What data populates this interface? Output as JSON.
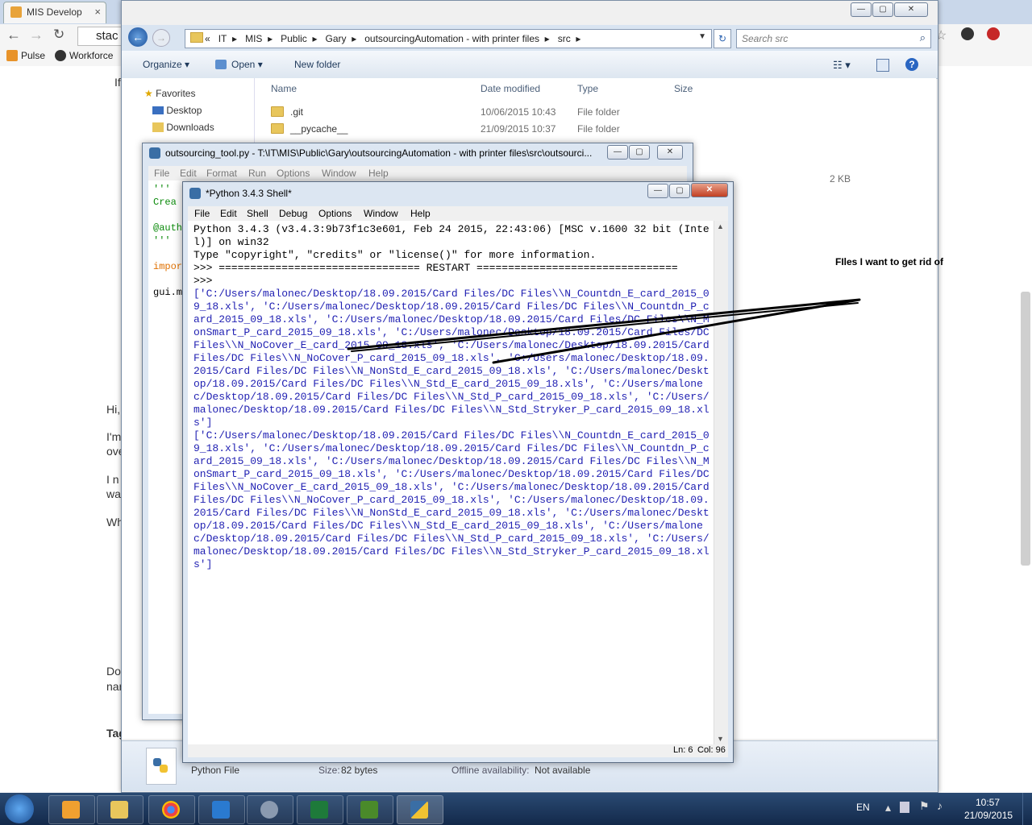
{
  "chrome": {
    "tab_title": "MIS Develop",
    "tab_close": "×",
    "address_partial": "stac",
    "bookmarks": [
      "Pulse",
      "Workforce"
    ],
    "page_fragments": [
      "If",
      "Hi,",
      "I'm",
      "ove",
      "I n",
      "wa",
      "Wh",
      "Do",
      "nar",
      "Tag"
    ]
  },
  "explorer": {
    "breadcrumb": [
      "«",
      "IT",
      "MIS",
      "Public",
      "Gary",
      "outsourcingAutomation - with printer files",
      "src"
    ],
    "search_placeholder": "Search src",
    "commands": {
      "organize": "Organize",
      "open": "Open",
      "new_folder": "New folder"
    },
    "nav": {
      "favorites": "Favorites",
      "desktop": "Desktop",
      "downloads": "Downloads"
    },
    "columns": {
      "name": "Name",
      "date": "Date modified",
      "type": "Type",
      "size": "Size"
    },
    "files": [
      {
        "name": ".git",
        "date": "10/06/2015 10:43",
        "type": "File folder"
      },
      {
        "name": "__pycache__",
        "date": "21/09/2015 10:37",
        "type": "File folder"
      }
    ],
    "partial_size": "2 KB",
    "details": {
      "type": "Python File",
      "size_label": "Size:",
      "size_value": "82 bytes",
      "offline_label": "Offline availability:",
      "offline_value": "Not available"
    }
  },
  "editor": {
    "title": "outsourcing_tool.py - T:\\IT\\MIS\\Public\\Gary\\outsourcingAutomation - with printer files\\src\\outsourci...",
    "menu": [
      "File",
      "Edit",
      "Format",
      "Run",
      "Options",
      "Window",
      "Help"
    ],
    "lines": [
      "'''",
      "Crea",
      "",
      "@auth",
      "'''",
      "",
      "impor",
      "",
      "gui.m"
    ]
  },
  "shell": {
    "title": "*Python 3.4.3 Shell*",
    "menu": [
      "File",
      "Edit",
      "Shell",
      "Debug",
      "Options",
      "Window",
      "Help"
    ],
    "header": "Python 3.4.3 (v3.4.3:9b73f1c3e601, Feb 24 2015, 22:43:06) [MSC v.1600 32 bit (Intel)] on win32\nType \"copyright\", \"credits\" or \"license()\" for more information.\n>>> ================================ RESTART ================================\n>>> ",
    "output1": "['C:/Users/malonec/Desktop/18.09.2015/Card Files/DC Files\\\\N_Countdn_E_card_2015_09_18.xls', 'C:/Users/malonec/Desktop/18.09.2015/Card Files/DC Files\\\\N_Countdn_P_card_2015_09_18.xls', 'C:/Users/malonec/Desktop/18.09.2015/Card Files/DC Files\\\\N_MonSmart_P_card_2015_09_18.xls', 'C:/Users/malonec/Desktop/18.09.2015/Card Files/DC Files\\\\N_NoCover_E_card_2015_09_18.xls', 'C:/Users/malonec/Desktop/18.09.2015/Card Files/DC Files\\\\N_NoCover_P_card_2015_09_18.xls', 'C:/Users/malonec/Desktop/18.09.2015/Card Files/DC Files\\\\N_NonStd_E_card_2015_09_18.xls', 'C:/Users/malonec/Desktop/18.09.2015/Card Files/DC Files\\\\N_Std_E_card_2015_09_18.xls', 'C:/Users/malonec/Desktop/18.09.2015/Card Files/DC Files\\\\N_Std_P_card_2015_09_18.xls', 'C:/Users/malonec/Desktop/18.09.2015/Card Files/DC Files\\\\N_Std_Stryker_P_card_2015_09_18.xls']",
    "output2": "['C:/Users/malonec/Desktop/18.09.2015/Card Files/DC Files\\\\N_Countdn_E_card_2015_09_18.xls', 'C:/Users/malonec/Desktop/18.09.2015/Card Files/DC Files\\\\N_Countdn_P_card_2015_09_18.xls', 'C:/Users/malonec/Desktop/18.09.2015/Card Files/DC Files\\\\N_MonSmart_P_card_2015_09_18.xls', 'C:/Users/malonec/Desktop/18.09.2015/Card Files/DC Files\\\\N_NoCover_E_card_2015_09_18.xls', 'C:/Users/malonec/Desktop/18.09.2015/Card Files/DC Files\\\\N_NoCover_P_card_2015_09_18.xls', 'C:/Users/malonec/Desktop/18.09.2015/Card Files/DC Files\\\\N_NonStd_E_card_2015_09_18.xls', 'C:/Users/malonec/Desktop/18.09.2015/Card Files/DC Files\\\\N_Std_E_card_2015_09_18.xls', 'C:/Users/malonec/Desktop/18.09.2015/Card Files/DC Files\\\\N_Std_P_card_2015_09_18.xls', 'C:/Users/malonec/Desktop/18.09.2015/Card Files/DC Files\\\\N_Std_Stryker_P_card_2015_09_18.xls']",
    "status_ln": "Ln: 6",
    "status_col": "Col: 96"
  },
  "annotation": {
    "text": "FIles I want to get rid of"
  },
  "taskbar": {
    "language": "EN",
    "time": "10:57",
    "date": "21/09/2015"
  },
  "colors": {
    "shell_output": "#1f1fb2",
    "taskbar": "#1b365c",
    "annotation_ink": "#000000"
  }
}
